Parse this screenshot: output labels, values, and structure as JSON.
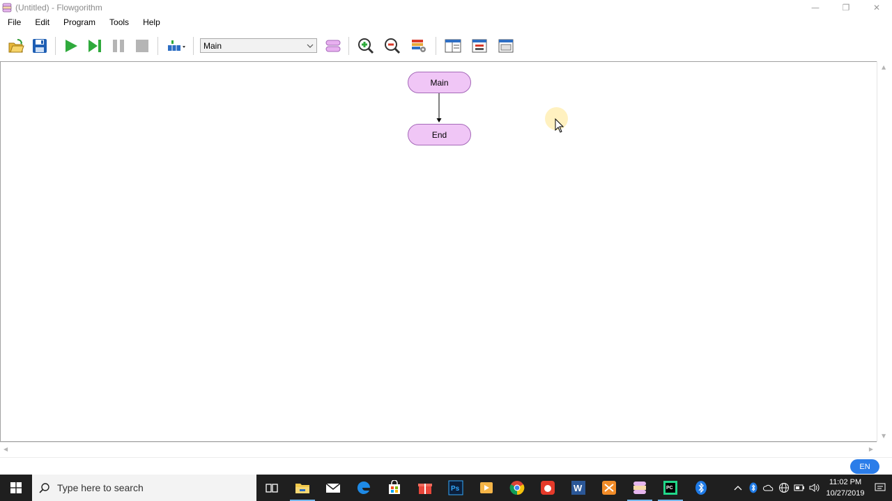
{
  "window": {
    "title": "(Untitled) - Flowgorithm",
    "controls": {
      "minimize": "—",
      "restore": "❐",
      "close": "✕"
    }
  },
  "menu": [
    "File",
    "Edit",
    "Program",
    "Tools",
    "Help"
  ],
  "toolbar": {
    "function_select": "Main",
    "buttons": [
      "open-icon",
      "save-icon",
      "run-icon",
      "step-icon",
      "pause-icon",
      "stop-icon",
      "layout-icon",
      "manage-functions-icon",
      "zoom-in-icon",
      "zoom-out-icon",
      "variable-watch-icon",
      "source-code-icon",
      "console-icon",
      "chart-icon"
    ]
  },
  "flowchart": {
    "start_label": "Main",
    "end_label": "End",
    "terminal_color": "#f0c6f6"
  },
  "status": {
    "language": "EN"
  },
  "taskbar": {
    "search_placeholder": "Type here to search",
    "time": "11:02 PM",
    "date": "10/27/2019",
    "apps": [
      "task-view",
      "file-explorer",
      "mail",
      "edge",
      "store",
      "gift",
      "photoshop",
      "media",
      "chrome",
      "app-red",
      "word",
      "app-orange",
      "flowgorithm",
      "pycharm",
      "bluetooth"
    ]
  }
}
